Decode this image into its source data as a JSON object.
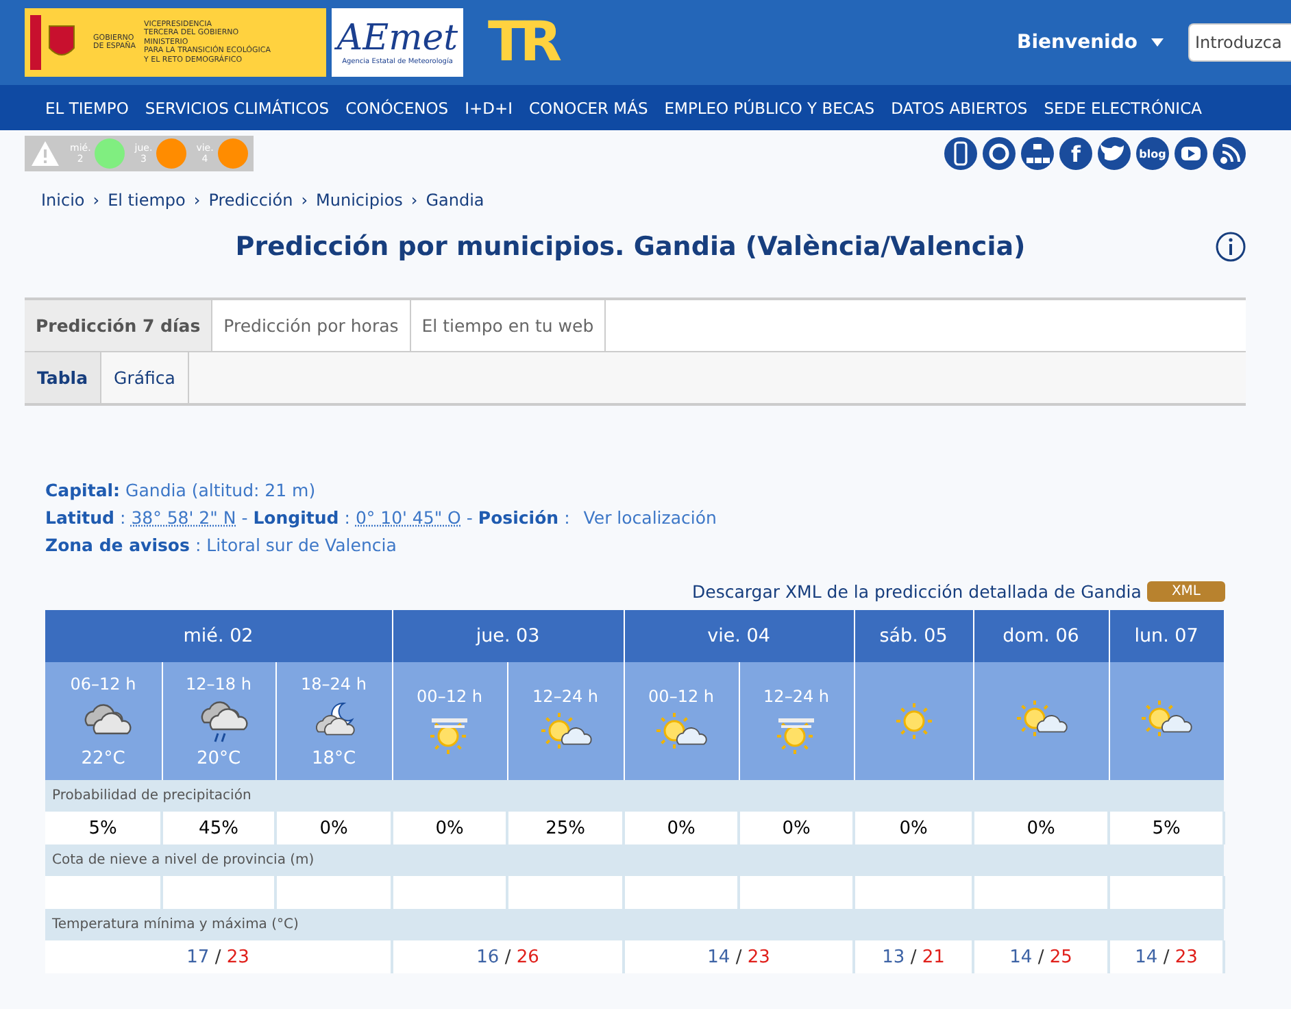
{
  "header": {
    "gov_lines": [
      "GOBIERNO",
      "DE ESPAÑA"
    ],
    "ministry_lines": [
      "VICEPRESIDENCIA",
      "TERCERA DEL GOBIERNO",
      "MINISTERIO",
      "PARA LA TRANSICIÓN ECOLÓGICA",
      "Y EL RETO DEMOGRÁFICO"
    ],
    "aemet_logo": "AEmet",
    "aemet_sub": "Agencia Estatal de Meteorología",
    "tr_logo": "TR",
    "welcome": "Bienvenido",
    "search": {
      "placeholder": "Introduzca"
    }
  },
  "nav": [
    "EL TIEMPO",
    "SERVICIOS CLIMÁTICOS",
    "CONÓCENOS",
    "I+D+I",
    "CONOCER MÁS",
    "EMPLEO PÚBLICO Y BECAS",
    "DATOS ABIERTOS",
    "SEDE ELECTRÓNICA"
  ],
  "warnings": [
    {
      "day": "mié.",
      "date": "2",
      "color": "#80ee80"
    },
    {
      "day": "jue.",
      "date": "3",
      "color": "#ff8c00"
    },
    {
      "day": "vie.",
      "date": "4",
      "color": "#ff8c00"
    }
  ],
  "social": [
    {
      "kind": "mobile"
    },
    {
      "kind": "support"
    },
    {
      "kind": "sitemap"
    },
    {
      "kind": "facebook",
      "label": "f"
    },
    {
      "kind": "twitter"
    },
    {
      "kind": "blog",
      "label": "blog"
    },
    {
      "kind": "youtube"
    },
    {
      "kind": "rss"
    }
  ],
  "breadcrumb": [
    {
      "label": "Inicio"
    },
    {
      "sep": "›",
      "label": "El tiempo"
    },
    {
      "sep": "›",
      "label": "Predicción"
    },
    {
      "sep": "›",
      "label": "Municipios"
    },
    {
      "sep": "›",
      "label": "Gandia"
    }
  ],
  "title": "Predicción por municipios. Gandia (València/Valencia)",
  "tabs": [
    {
      "label": "Predicción 7 días",
      "selected": true
    },
    {
      "label": "Predicción por horas",
      "selected": false
    },
    {
      "label": "El tiempo en tu web",
      "selected": false
    }
  ],
  "subtabs": [
    {
      "label": "Tabla",
      "selected": true
    },
    {
      "label": "Gráfica",
      "selected": false
    }
  ],
  "info": [
    [
      {
        "kind": "label",
        "text": "Capital:"
      },
      {
        "kind": "value",
        "text": "Gandia (altitud: 21 m)"
      }
    ],
    [
      {
        "kind": "label",
        "text": "Latitud"
      },
      {
        "kind": "sep",
        "text": ":"
      },
      {
        "kind": "coord",
        "text": "38° 58' 2\" N"
      },
      {
        "kind": "sep",
        "text": "-"
      },
      {
        "kind": "label",
        "text": "Longitud"
      },
      {
        "kind": "sep",
        "text": ":"
      },
      {
        "kind": "coord",
        "text": "0° 10' 45\" O"
      },
      {
        "kind": "sep",
        "text": "-"
      },
      {
        "kind": "label",
        "text": "Posición"
      },
      {
        "kind": "sep",
        "text": ":"
      },
      {
        "kind": "link",
        "text": "Ver localización"
      }
    ],
    [
      {
        "kind": "label",
        "text": "Zona de avisos"
      },
      {
        "kind": "sep",
        "text": ":"
      },
      {
        "kind": "value",
        "text": "Litoral sur de Valencia"
      }
    ]
  ],
  "download": {
    "text": "Descargar XML de la predicción detallada de Gandia",
    "badge": "XML"
  },
  "forecast": {
    "days": [
      {
        "label": "mié. 02",
        "min": "17",
        "sep": "/",
        "max": "23",
        "periods": [
          {
            "time": "06–12 h",
            "kind": "cloudy",
            "temp": "22°C",
            "precip": "5%"
          },
          {
            "time": "12–18 h",
            "kind": "rain",
            "temp": "20°C",
            "precip": "45%"
          },
          {
            "time": "18–24 h",
            "kind": "night_cloud",
            "temp": "18°C",
            "precip": "0%"
          }
        ]
      },
      {
        "label": "jue. 03",
        "min": "16",
        "sep": "/",
        "max": "26",
        "periods": [
          {
            "time": "00–12 h",
            "kind": "haze_sun",
            "precip": "0%"
          },
          {
            "time": "12–24 h",
            "kind": "sun_cloud",
            "precip": "25%"
          }
        ]
      },
      {
        "label": "vie. 04",
        "min": "14",
        "sep": "/",
        "max": "23",
        "periods": [
          {
            "time": "00–12 h",
            "kind": "sun_cloud",
            "precip": "0%"
          },
          {
            "time": "12–24 h",
            "kind": "haze_sun",
            "precip": "0%"
          }
        ]
      },
      {
        "label": "sáb. 05",
        "min": "13",
        "sep": "/",
        "max": "21",
        "periods": [
          {
            "kind": "sun",
            "precip": "0%"
          }
        ]
      },
      {
        "label": "dom. 06",
        "min": "14",
        "sep": "/",
        "max": "25",
        "periods": [
          {
            "kind": "sun_cloud",
            "precip": "0%"
          }
        ]
      },
      {
        "label": "lun. 07",
        "min": "14",
        "sep": "/",
        "max": "23",
        "periods": [
          {
            "kind": "sun_cloud",
            "precip": "5%"
          }
        ]
      }
    ],
    "precip_label": "Probabilidad de precipitación",
    "snow_label": "Cota de nieve a nivel de provincia (m)",
    "temp_label": "Temperatura mínima y máxima (°C)"
  }
}
